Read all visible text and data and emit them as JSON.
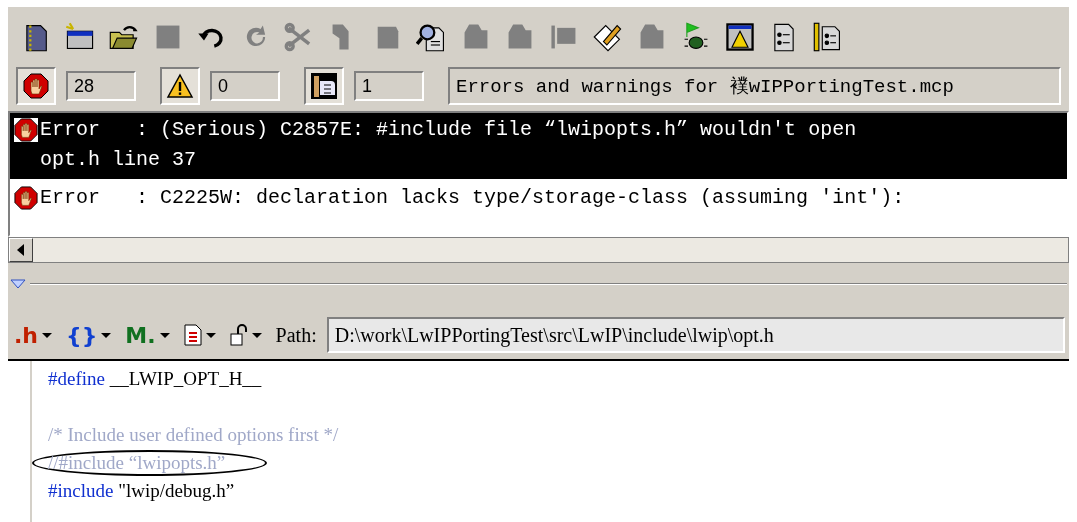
{
  "toolbar": [
    {
      "kind": "newfile",
      "disabled": false
    },
    {
      "kind": "newwindow",
      "disabled": false
    },
    {
      "kind": "open",
      "disabled": false
    },
    {
      "kind": "save",
      "disabled": true
    },
    {
      "kind": "undo",
      "disabled": false
    },
    {
      "kind": "redo",
      "disabled": true
    },
    {
      "kind": "cut",
      "disabled": true
    },
    {
      "kind": "copy",
      "disabled": true
    },
    {
      "kind": "paste",
      "disabled": true
    },
    {
      "kind": "find",
      "disabled": false
    },
    {
      "kind": "blob",
      "disabled": true
    },
    {
      "kind": "blob",
      "disabled": true
    },
    {
      "kind": "flag",
      "disabled": true
    },
    {
      "kind": "pencil",
      "disabled": false
    },
    {
      "kind": "blob",
      "disabled": true
    },
    {
      "kind": "bug",
      "disabled": false
    },
    {
      "kind": "warnwindow",
      "disabled": false
    },
    {
      "kind": "list",
      "disabled": false
    },
    {
      "kind": "stripelist",
      "disabled": false
    }
  ],
  "filters": [
    {
      "kind": "error",
      "on": true,
      "count": "28"
    },
    {
      "kind": "warning",
      "on": true,
      "count": "0"
    },
    {
      "kind": "info",
      "on": true,
      "count": "1"
    }
  ],
  "status_text": "Errors and warnings for 襆wIPPortingTest.mcp",
  "messages": [
    {
      "selected": true,
      "lines": [
        "Error   : (Serious) C2857E: #include file “lwipopts.h” wouldn't open",
        "opt.h line 37"
      ]
    },
    {
      "selected": false,
      "lines": [
        "Error   : C2225W: declaration lacks type/storage-class (assuming 'int'):"
      ]
    }
  ],
  "code_toolbar": {
    "popups": [
      {
        "kind": "header",
        "glyph": ".h"
      },
      {
        "kind": "braces",
        "glyph": "{}"
      },
      {
        "kind": "marker",
        "glyph": "M."
      },
      {
        "kind": "doc"
      },
      {
        "kind": "lock"
      }
    ],
    "path_label": "Path:",
    "path": "D:\\work\\LwIPPortingTest\\src\\LwIP\\include\\lwip\\opt.h"
  },
  "code_lines": [
    {
      "kind": "directive",
      "keyword": "#define",
      "rest": " __LWIP_OPT_H__"
    },
    {
      "kind": "blank"
    },
    {
      "kind": "comment",
      "text": "/* Include user defined options first */",
      "circled": false
    },
    {
      "kind": "comment",
      "text": "//#include “lwipopts.h”",
      "circled": true
    },
    {
      "kind": "directive",
      "keyword": "#include",
      "rest": " \"lwip/debug.h”"
    }
  ]
}
